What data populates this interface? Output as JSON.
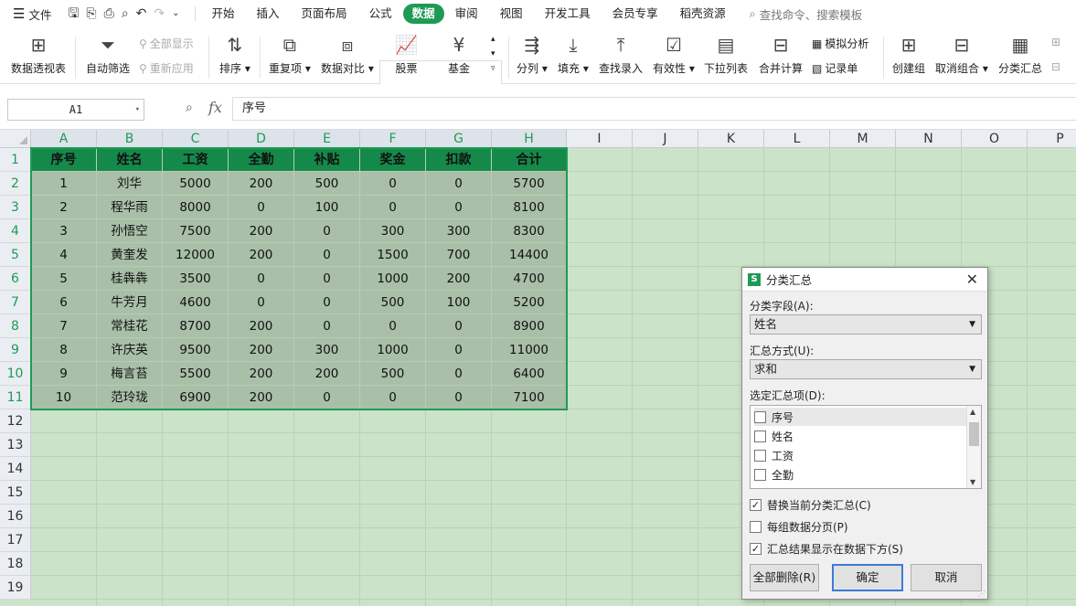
{
  "menubar": {
    "file_label": "文件",
    "tabs": [
      "开始",
      "插入",
      "页面布局",
      "公式",
      "数据",
      "审阅",
      "视图",
      "开发工具",
      "会员专享",
      "稻壳资源"
    ],
    "active_tab": "数据",
    "search_placeholder": "查找命令、搜索模板"
  },
  "ribbon": {
    "pivot": "数据透视表",
    "autofilter": "自动筛选",
    "show_all": "全部显示",
    "reapply": "重新应用",
    "sort": "排序",
    "duplicates": "重复项",
    "compare": "数据对比",
    "stock": "股票",
    "fund": "基金",
    "split": "分列",
    "fill": "填充",
    "lookup": "查找录入",
    "validity": "有效性",
    "dropdown_list": "下拉列表",
    "consolidate": "合并计算",
    "whatif": "模拟分析",
    "record": "记录单",
    "group": "创建组",
    "ungroup": "取消组合",
    "subtotal": "分类汇总"
  },
  "formula": {
    "name_box": "A1",
    "fx": "fx",
    "content": "序号"
  },
  "sheet": {
    "columns": [
      "A",
      "B",
      "C",
      "D",
      "E",
      "F",
      "G",
      "H",
      "I",
      "J",
      "K",
      "L",
      "M",
      "N",
      "O",
      "P"
    ],
    "rows": [
      "1",
      "2",
      "3",
      "4",
      "5",
      "6",
      "7",
      "8",
      "9",
      "10",
      "11",
      "12",
      "13",
      "14",
      "15",
      "16",
      "17",
      "18",
      "19"
    ],
    "header": [
      "序号",
      "姓名",
      "工资",
      "全勤",
      "补贴",
      "奖金",
      "扣款",
      "合计"
    ],
    "data": [
      [
        "1",
        "刘华",
        "5000",
        "200",
        "500",
        "0",
        "0",
        "5700"
      ],
      [
        "2",
        "程华雨",
        "8000",
        "0",
        "100",
        "0",
        "0",
        "8100"
      ],
      [
        "3",
        "孙悟空",
        "7500",
        "200",
        "0",
        "300",
        "300",
        "8300"
      ],
      [
        "4",
        "黄奎发",
        "12000",
        "200",
        "0",
        "1500",
        "700",
        "14400"
      ],
      [
        "5",
        "桂犇犇",
        "3500",
        "0",
        "0",
        "1000",
        "200",
        "4700"
      ],
      [
        "6",
        "牛芳月",
        "4600",
        "0",
        "0",
        "500",
        "100",
        "5200"
      ],
      [
        "7",
        "常桂花",
        "8700",
        "200",
        "0",
        "0",
        "0",
        "8900"
      ],
      [
        "8",
        "许庆英",
        "9500",
        "200",
        "300",
        "1000",
        "0",
        "11000"
      ],
      [
        "9",
        "梅言苔",
        "5500",
        "200",
        "200",
        "500",
        "0",
        "6400"
      ],
      [
        "10",
        "范玲珑",
        "6900",
        "200",
        "0",
        "0",
        "0",
        "7100"
      ]
    ]
  },
  "dialog": {
    "title": "分类汇总",
    "field_label": "分类字段(A):",
    "field_value": "姓名",
    "method_label": "汇总方式(U):",
    "method_value": "求和",
    "items_label": "选定汇总项(D):",
    "items": [
      {
        "label": "序号",
        "checked": false
      },
      {
        "label": "姓名",
        "checked": false
      },
      {
        "label": "工资",
        "checked": false
      },
      {
        "label": "全勤",
        "checked": false
      }
    ],
    "replace_label": "替换当前分类汇总(C)",
    "replace_checked": true,
    "pagebreak_label": "每组数据分页(P)",
    "pagebreak_checked": false,
    "below_label": "汇总结果显示在数据下方(S)",
    "below_checked": true,
    "delete_all": "全部删除(R)",
    "ok": "确定",
    "cancel": "取消"
  }
}
